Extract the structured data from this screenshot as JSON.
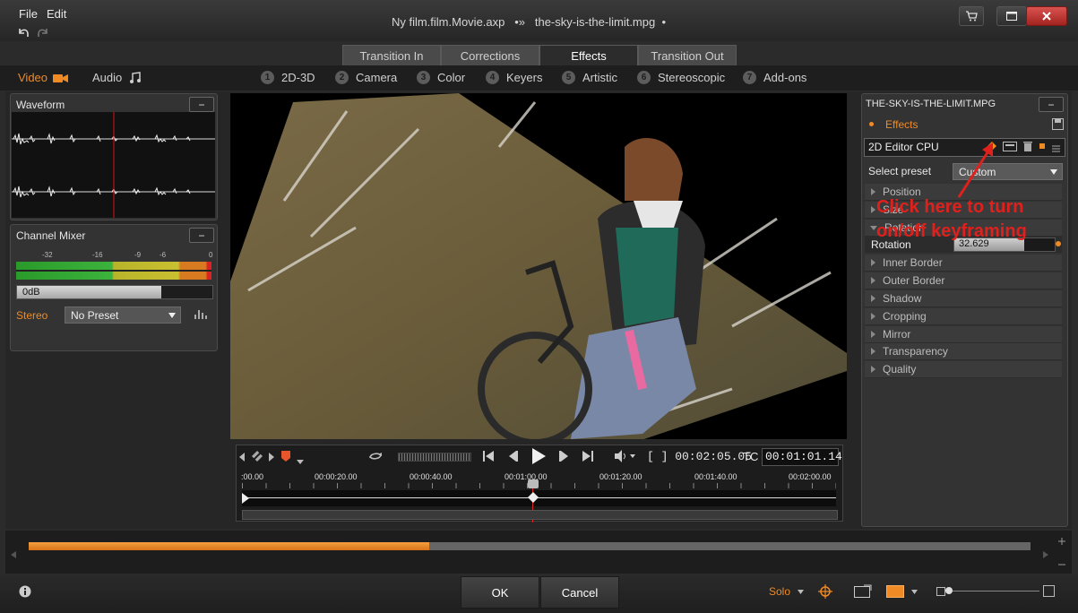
{
  "menu": {
    "file": "File",
    "edit": "Edit"
  },
  "window": {
    "project": "Ny film.film.Movie.axp",
    "separator_glyph": "•»",
    "clip": "the-sky-is-the-limit.mpg",
    "modified_glyph": "•"
  },
  "tabs": [
    {
      "label": "Transition In",
      "active": false
    },
    {
      "label": "Corrections",
      "active": false
    },
    {
      "label": "Effects",
      "active": true
    },
    {
      "label": "Transition Out",
      "active": false
    }
  ],
  "media": {
    "video": "Video",
    "audio": "Audio"
  },
  "categories": [
    {
      "num": "1",
      "label": "2D-3D"
    },
    {
      "num": "2",
      "label": "Camera"
    },
    {
      "num": "3",
      "label": "Color"
    },
    {
      "num": "4",
      "label": "Keyers"
    },
    {
      "num": "5",
      "label": "Artistic"
    },
    {
      "num": "6",
      "label": "Stereoscopic"
    },
    {
      "num": "7",
      "label": "Add-ons"
    }
  ],
  "waveform": {
    "title": "Waveform",
    "minimize": "−"
  },
  "mixer": {
    "title": "Channel Mixer",
    "minimize": "−",
    "scale": [
      "-32",
      "-16",
      "-9",
      "-6",
      "0"
    ],
    "level": "0dB",
    "level_fraction": 0.74,
    "mode": "Stereo",
    "preset": "No Preset"
  },
  "transport": {
    "duration": "[ ] 00:02:05.05",
    "tc_label": "TC",
    "timecode": "00:01:01.14"
  },
  "timeline": {
    "ticks": [
      ":00.00",
      "00:00:20.00",
      "00:00:40.00",
      "00:01:00.00",
      "00:01:20.00",
      "00:01:40.00",
      "00:02:00.00"
    ],
    "playhead_fraction": 0.49
  },
  "fx": {
    "clip_title": "THE-SKY-IS-THE-LIMIT.MPG",
    "minimize": "−",
    "effects_label": "Effects",
    "editor": "2D Editor CPU",
    "preset_label": "Select preset",
    "preset_value": "Custom",
    "groups_top": [
      "Position",
      "Size",
      "Rotation"
    ],
    "rotation_label": "Rotation",
    "rotation_value": "32.629",
    "rotation_fraction": 0.7,
    "groups": [
      "Inner Border",
      "Outer Border",
      "Shadow",
      "Cropping",
      "Mirror",
      "Transparency",
      "Quality"
    ]
  },
  "annotation": {
    "line1": "Click here to turn",
    "line2": "on/off keyframing",
    "color": "#e0201c"
  },
  "progress": {
    "fraction": 0.4
  },
  "footer": {
    "ok": "OK",
    "cancel": "Cancel",
    "solo": "Solo"
  },
  "colors": {
    "accent": "#f08a24",
    "panel": "#333333"
  }
}
